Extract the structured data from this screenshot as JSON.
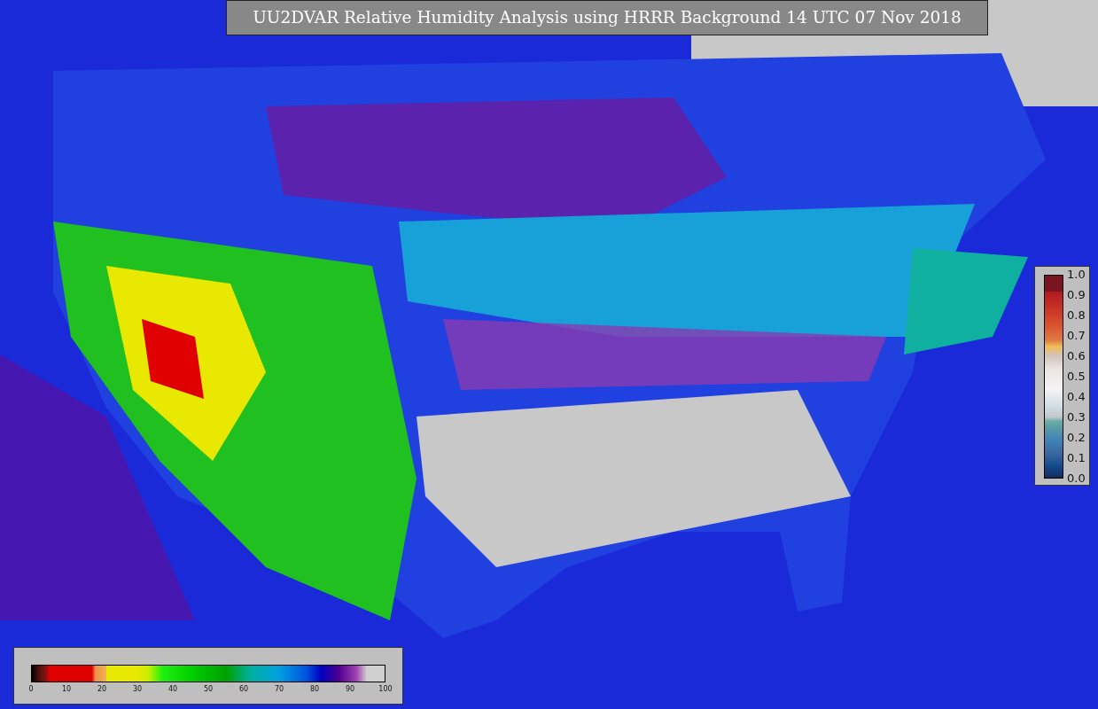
{
  "title": "UU2DVAR Relative Humidity Analysis using HRRR Background 14 UTC 07 Nov 2018",
  "ratio_legend": {
    "ticks": [
      "1.0",
      "0.9",
      "0.8",
      "0.7",
      "0.6",
      "0.5",
      "0.4",
      "0.3",
      "0.2",
      "0.1",
      "0.0"
    ]
  },
  "humidity_legend": {
    "ticks": [
      "0",
      "10",
      "20",
      "30",
      "40",
      "50",
      "60",
      "70",
      "80",
      "90",
      "100"
    ]
  }
}
